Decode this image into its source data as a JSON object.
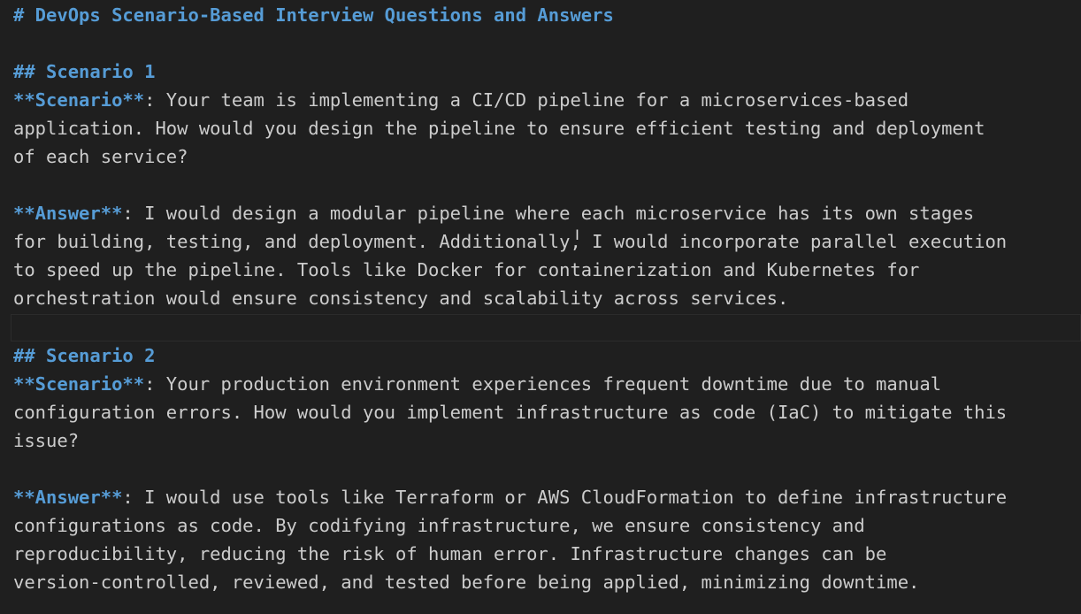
{
  "document": {
    "title": "# DevOps Scenario-Based Interview Questions and Answers",
    "scenarios": [
      {
        "heading": "## Scenario 1",
        "scenario_label": "**Scenario**",
        "scenario_lines": [
          ": Your team is implementing a CI/CD pipeline for a microservices-based",
          "application. How would you design the pipeline to ensure efficient testing and deployment",
          "of each service?"
        ],
        "answer_label": "**Answer**",
        "answer_lines": [
          ": I would design a modular pipeline where each microservice has its own stages",
          "for building, testing, and deployment. Additionally, I would incorporate parallel execution",
          "to speed up the pipeline. Tools like Docker for containerization and Kubernetes for",
          "orchestration would ensure consistency and scalability across services."
        ]
      },
      {
        "heading": "## Scenario 2",
        "scenario_label": "**Scenario**",
        "scenario_lines": [
          ": Your production environment experiences frequent downtime due to manual",
          "configuration errors. How would you implement infrastructure as code (IaC) to mitigate this",
          "issue?"
        ],
        "answer_label": "**Answer**",
        "answer_lines": [
          ": I would use tools like Terraform or AWS CloudFormation to define infrastructure",
          "configurations as code. By codifying infrastructure, we ensure consistency and",
          "reproducibility, reducing the risk of human error. Infrastructure changes can be",
          "version-controlled, reviewed, and tested before being applied, minimizing downtime."
        ]
      }
    ]
  },
  "cursor": {
    "icon": "text-cursor-icon",
    "glyph": "I"
  },
  "colors": {
    "background": "#1f1f1f",
    "text": "#cccccc",
    "markdown_accent": "#569cd6"
  }
}
